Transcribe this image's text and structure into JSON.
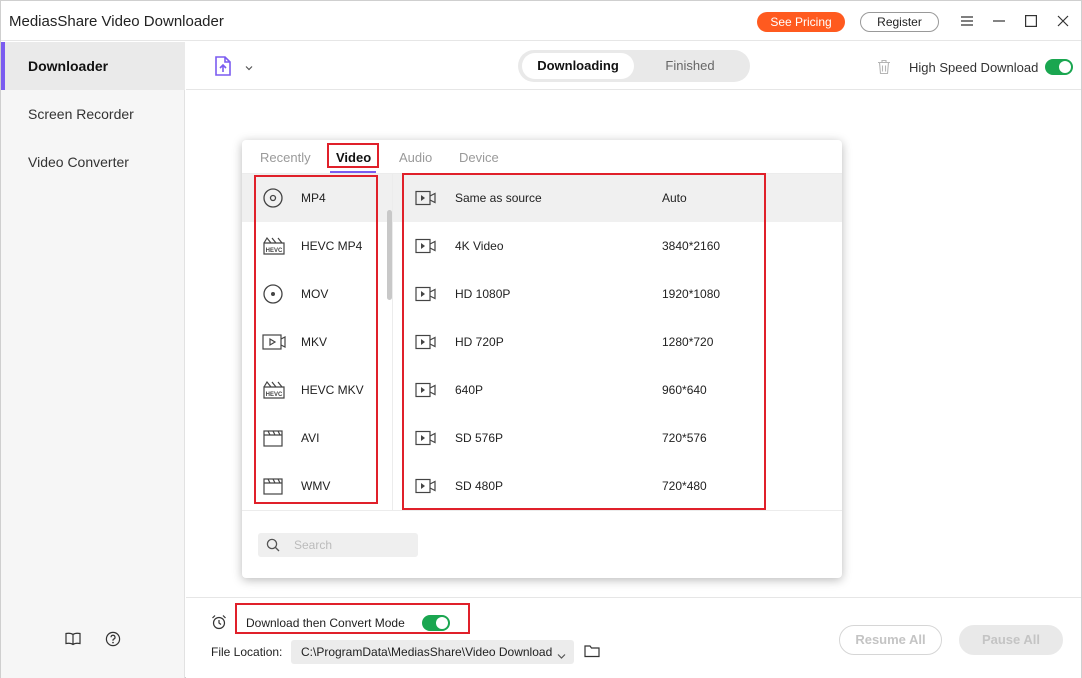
{
  "titlebar": {
    "title": "MediasShare Video Downloader",
    "pricing_label": "See Pricing",
    "register_label": "Register"
  },
  "sidebar": {
    "items": [
      {
        "label": "Downloader"
      },
      {
        "label": "Screen Recorder"
      },
      {
        "label": "Video Converter"
      }
    ]
  },
  "header": {
    "tabs": [
      {
        "label": "Downloading"
      },
      {
        "label": "Finished"
      }
    ],
    "high_speed_label": "High Speed Download",
    "high_speed_on": true
  },
  "popup": {
    "tabs": [
      {
        "label": "Recently"
      },
      {
        "label": "Video"
      },
      {
        "label": "Audio"
      },
      {
        "label": "Device"
      }
    ],
    "formats": [
      {
        "label": "MP4",
        "icon": "disc-icon"
      },
      {
        "label": "HEVC MP4",
        "icon": "hevc-icon"
      },
      {
        "label": "MOV",
        "icon": "disc-icon"
      },
      {
        "label": "MKV",
        "icon": "video-file-icon"
      },
      {
        "label": "HEVC MKV",
        "icon": "hevc-icon"
      },
      {
        "label": "AVI",
        "icon": "clapper-icon"
      },
      {
        "label": "WMV",
        "icon": "clapper-icon"
      }
    ],
    "resolutions": [
      {
        "name": "Same as source",
        "size": "Auto"
      },
      {
        "name": "4K Video",
        "size": "3840*2160"
      },
      {
        "name": "HD 1080P",
        "size": "1920*1080"
      },
      {
        "name": "HD 720P",
        "size": "1280*720"
      },
      {
        "name": "640P",
        "size": "960*640"
      },
      {
        "name": "SD 576P",
        "size": "720*576"
      },
      {
        "name": "SD 480P",
        "size": "720*480"
      }
    ],
    "search_placeholder": "Search"
  },
  "footer": {
    "convert_mode_label": "Download then Convert Mode",
    "convert_mode_on": true,
    "file_location_label": "File Location:",
    "file_location_value": "C:\\ProgramData\\MediasShare\\Video Download",
    "resume_label": "Resume All",
    "pause_label": "Pause All"
  },
  "colors": {
    "accent": "#7b5cf0",
    "pricing": "#ff5a1f",
    "toggle_on": "#1aa650",
    "highlight_box": "#e0202a"
  }
}
